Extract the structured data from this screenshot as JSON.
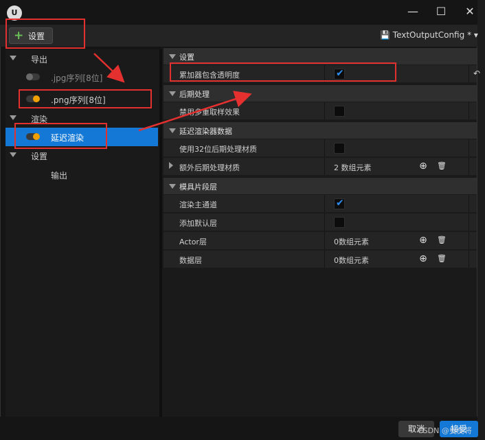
{
  "window": {
    "config_name": "TextOutputConfig",
    "config_suffix": "*",
    "minimize_glyph": "—",
    "maximize_glyph": "☐",
    "close_glyph": "✕"
  },
  "toolbar": {
    "settings_label": "设置",
    "add_glyph": "+",
    "save_glyph": "💾",
    "dropdown_glyph": "▾"
  },
  "left_tree": {
    "items": [
      {
        "label": "导出",
        "type": "category"
      },
      {
        "label": ".jpg序列[8位]",
        "type": "toggle",
        "enabled": false
      },
      {
        "label": ".png序列[8位]",
        "type": "toggle",
        "enabled": true
      },
      {
        "label": "渲染",
        "type": "category"
      },
      {
        "label": "延迟渲染",
        "type": "toggle",
        "enabled": true,
        "selected": true
      },
      {
        "label": "设置",
        "type": "category"
      },
      {
        "label": "输出",
        "type": "leaf"
      }
    ]
  },
  "details": {
    "sections": [
      {
        "title": "设置",
        "rows": [
          {
            "name": "累加器包含透明度",
            "checked": true
          }
        ]
      },
      {
        "title": "后期处理",
        "rows": [
          {
            "name": "禁用多重取样效果",
            "checked": false
          }
        ]
      },
      {
        "title": "延迟渲染器数据",
        "rows": [
          {
            "name": "使用32位后期处理材质",
            "checked": false
          },
          {
            "name": "额外后期处理材质",
            "value": "2 数组元素"
          }
        ]
      },
      {
        "title": "模具片段层",
        "rows": [
          {
            "name": "渲染主通道",
            "checked": true
          },
          {
            "name": "添加默认层",
            "checked": false
          },
          {
            "name": "Actor层",
            "value": "0数组元素"
          },
          {
            "name": "数据层",
            "value": "0数组元素"
          }
        ]
      }
    ],
    "check_glyph": "✔",
    "add_glyph": "⊕",
    "delete_glyph": "🗑",
    "reset_glyph": "↶"
  },
  "footer": {
    "cancel_label": "取消",
    "confirm_label": "接受",
    "watermark": "CSDN @曳曳将"
  },
  "colors": {
    "accent": "#1479d6",
    "toggle_on": "#f0a000",
    "annotation_red": "#e53030",
    "check_blue": "#2f8cf0"
  }
}
